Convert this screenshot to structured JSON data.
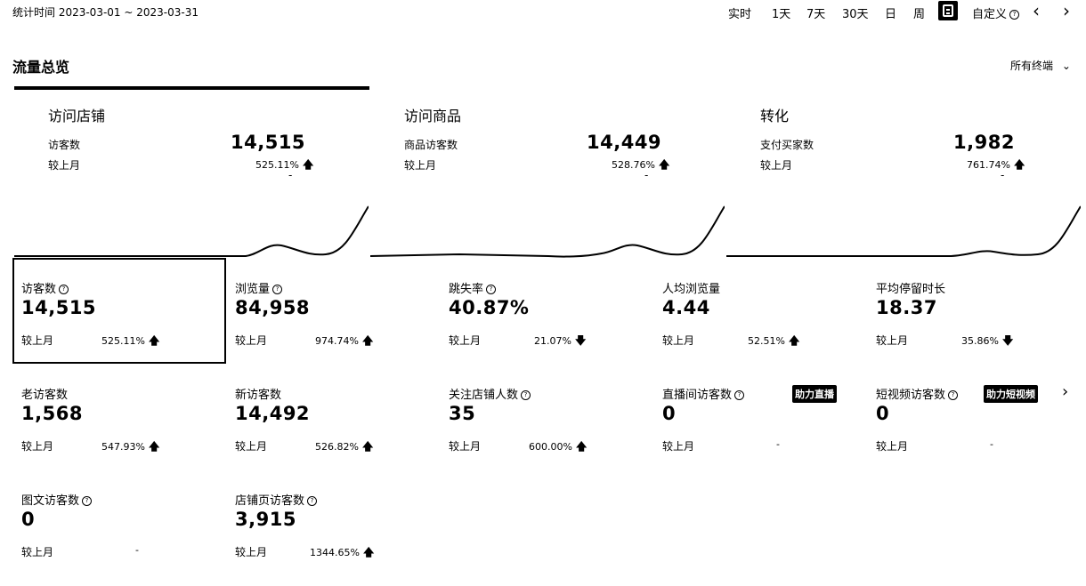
{
  "header": {
    "stat_time": "统计时间 2023-03-01 ~ 2023-03-31",
    "periods": [
      "实时",
      "1天",
      "7天",
      "30天",
      "日",
      "周"
    ],
    "custom_label": "自定义",
    "prev_icon": "chevron-left-icon",
    "next_icon": "chevron-right-icon"
  },
  "section": {
    "title": "流量总览",
    "terminal_filter": "所有终端"
  },
  "overview": [
    {
      "title": "访问店铺",
      "label": "访客数",
      "value": "14,515",
      "compare": "较上月",
      "delta": "525.11%",
      "dir": "up",
      "dash": "-"
    },
    {
      "title": "访问商品",
      "label": "商品访客数",
      "value": "14,449",
      "compare": "较上月",
      "delta": "528.76%",
      "dir": "up",
      "dash": "-"
    },
    {
      "title": "转化",
      "label": "支付买家数",
      "value": "1,982",
      "compare": "较上月",
      "delta": "761.74%",
      "dir": "up",
      "dash": "-"
    }
  ],
  "metrics": [
    {
      "label": "访客数",
      "value": "14,515",
      "compare": "较上月",
      "delta": "525.11%",
      "dir": "up"
    },
    {
      "label": "浏览量",
      "value": "84,958",
      "compare": "较上月",
      "delta": "974.74%",
      "dir": "up"
    },
    {
      "label": "跳失率",
      "value": "40.87%",
      "compare": "较上月",
      "delta": "21.07%",
      "dir": "down"
    },
    {
      "label": "人均浏览量",
      "value": "4.44",
      "compare": "较上月",
      "delta": "52.51%",
      "dir": "up"
    },
    {
      "label": "平均停留时长",
      "value": "18.37",
      "compare": "较上月",
      "delta": "35.86%",
      "dir": "down"
    },
    {
      "label": "老访客数",
      "value": "1,568",
      "compare": "较上月",
      "delta": "547.93%",
      "dir": "up"
    },
    {
      "label": "新访客数",
      "value": "14,492",
      "compare": "较上月",
      "delta": "526.82%",
      "dir": "up"
    },
    {
      "label": "关注店铺人数",
      "value": "35",
      "compare": "较上月",
      "delta": "600.00%",
      "dir": "up"
    },
    {
      "label": "直播间访客数",
      "value": "0",
      "compare": "较上月",
      "delta": "-",
      "dir": "none"
    },
    {
      "label": "短视频访客数",
      "value": "0",
      "compare": "较上月",
      "delta": "-",
      "dir": "none"
    },
    {
      "label": "图文访客数",
      "value": "0",
      "compare": "较上月",
      "delta": "-",
      "dir": "none"
    },
    {
      "label": "店铺页访客数",
      "value": "3,915",
      "compare": "较上月",
      "delta": "1344.65%",
      "dir": "up"
    }
  ],
  "badges": {
    "live": "助力直播",
    "video": "助力短视频"
  },
  "symbols": {
    "question": "?",
    "up": "🡅",
    "down": "🡇",
    "chev_down": "⌄",
    "chev_left": "‹",
    "chev_right": "›"
  }
}
